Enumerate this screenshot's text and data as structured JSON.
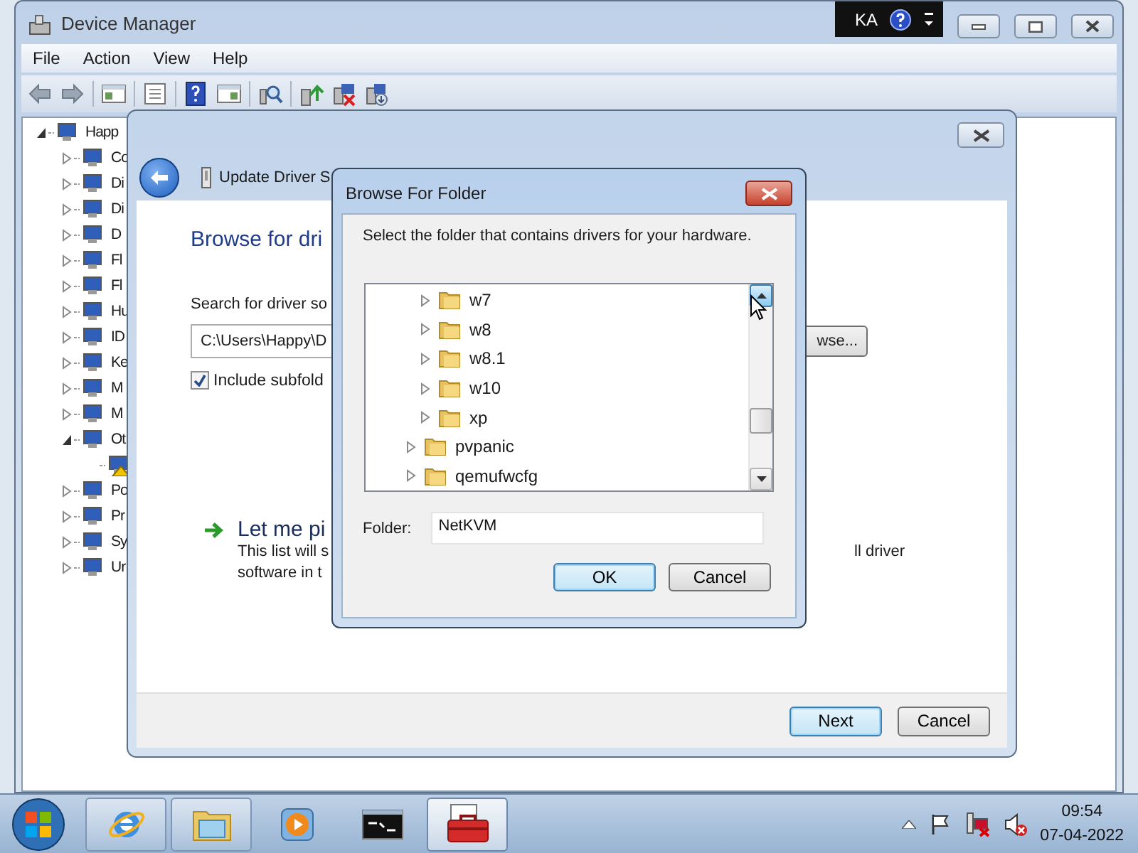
{
  "device_manager": {
    "title": "Device Manager",
    "language_bar": {
      "label": "KA"
    },
    "menu": [
      "File",
      "Action",
      "View",
      "Help"
    ],
    "tree": [
      {
        "label": "Happ",
        "expanded": true,
        "children": [
          {
            "label": "Co",
            "expanded": false
          },
          {
            "label": "Di",
            "expanded": false
          },
          {
            "label": "Di",
            "expanded": false
          },
          {
            "label": "D",
            "expanded": false
          },
          {
            "label": "Fl",
            "expanded": false
          },
          {
            "label": "Fl",
            "expanded": false
          },
          {
            "label": "Hu",
            "expanded": false
          },
          {
            "label": "ID",
            "expanded": false
          },
          {
            "label": "Ke",
            "expanded": false
          },
          {
            "label": "M",
            "expanded": false
          },
          {
            "label": "M",
            "expanded": false
          },
          {
            "label": "Ot",
            "expanded": true,
            "children": [
              {
                "warning": true
              }
            ]
          },
          {
            "label": "Po",
            "expanded": false
          },
          {
            "label": "Pr",
            "expanded": false
          },
          {
            "label": "Sy",
            "expanded": false
          },
          {
            "label": "Ur",
            "expanded": false
          }
        ]
      }
    ]
  },
  "update_driver_wizard": {
    "title": "Update Driver S",
    "heading": "Browse for dri",
    "search_label": "Search for driver so",
    "path_value": "C:\\Users\\Happy\\D",
    "browse_button": "wse...",
    "include_subfolders": {
      "label": "Include subfold",
      "checked": true
    },
    "pick_option": {
      "title": "Let me pi",
      "lines": [
        "This list will s",
        "software in t"
      ],
      "line_tail": "ll driver"
    },
    "buttons": [
      {
        "label": "Next",
        "default": true
      },
      {
        "label": "Cancel",
        "default": false
      }
    ]
  },
  "browse_for_folder": {
    "title": "Browse For Folder",
    "instruction": "Select the folder that contains drivers for your hardware.",
    "folders": [
      {
        "children": [
          {
            "label": "w7",
            "expanded": false
          },
          {
            "label": "w8",
            "expanded": false
          },
          {
            "label": "w8.1",
            "expanded": false
          },
          {
            "label": "w10",
            "expanded": false
          },
          {
            "label": "xp",
            "expanded": false
          }
        ]
      },
      {
        "label": "pvpanic",
        "expanded": false
      },
      {
        "label": "qemufwcfg",
        "expanded": false
      }
    ],
    "folder_label": "Folder:",
    "folder_value": "NetKVM",
    "buttons": [
      {
        "label": "OK",
        "default": true
      },
      {
        "label": "Cancel",
        "default": false
      }
    ]
  },
  "taskbar": {
    "apps": [
      {
        "kind": "browser",
        "running": true,
        "selected": false
      },
      {
        "kind": "explorer",
        "running": true,
        "selected": false
      },
      {
        "kind": "media",
        "running": false,
        "selected": false
      },
      {
        "kind": "terminal",
        "running": false,
        "selected": false
      },
      {
        "kind": "toolbox",
        "running": true,
        "selected": true
      }
    ],
    "clock": {
      "time": "09:54",
      "date": "07-04-2022"
    }
  }
}
